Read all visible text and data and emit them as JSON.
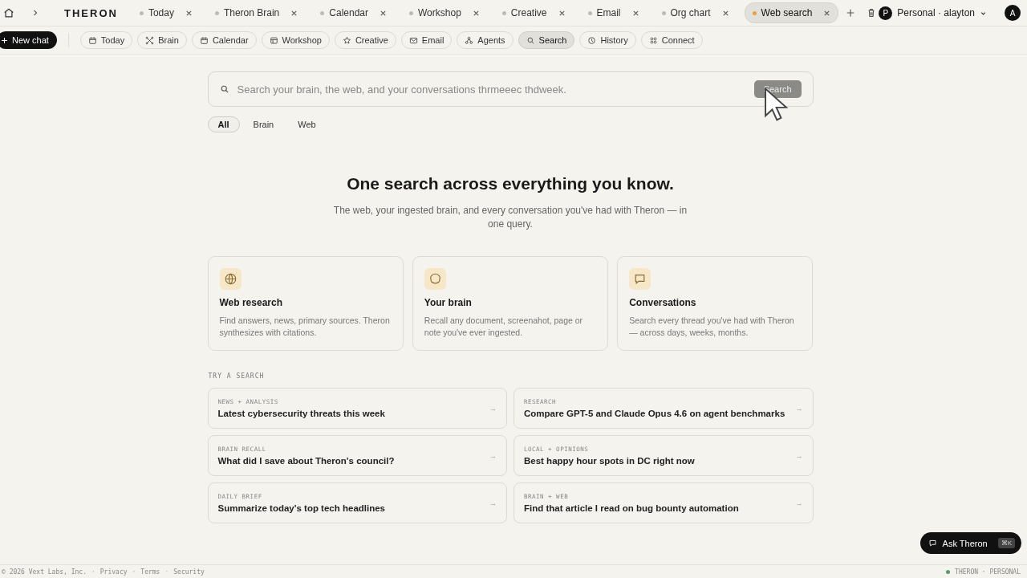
{
  "brand": "THERON",
  "tabs": [
    {
      "label": "Today",
      "selected": false
    },
    {
      "label": "Theron Brain",
      "selected": false
    },
    {
      "label": "Calendar",
      "selected": false
    },
    {
      "label": "Workshop",
      "selected": false
    },
    {
      "label": "Creative",
      "selected": false
    },
    {
      "label": "Email",
      "selected": false
    },
    {
      "label": "Org chart",
      "selected": false
    },
    {
      "label": "Web search",
      "selected": true
    }
  ],
  "account": {
    "avatar": "P",
    "label": "Personal · alayton",
    "user_avatar": "A"
  },
  "new_chat": "New chat",
  "nav": [
    {
      "label": "Today",
      "selected": false
    },
    {
      "label": "Brain",
      "selected": false
    },
    {
      "label": "Calendar",
      "selected": false
    },
    {
      "label": "Workshop",
      "selected": false
    },
    {
      "label": "Creative",
      "selected": false
    },
    {
      "label": "Email",
      "selected": false
    },
    {
      "label": "Agents",
      "selected": false
    },
    {
      "label": "Search",
      "selected": true
    },
    {
      "label": "History",
      "selected": false
    },
    {
      "label": "Connect",
      "selected": false
    }
  ],
  "search": {
    "value": "Search your brain, the web, and your conversations thrmeeec thdweek.",
    "button": "Search"
  },
  "filters": [
    {
      "label": "All",
      "selected": true
    },
    {
      "label": "Brain",
      "selected": false
    },
    {
      "label": "Web",
      "selected": false
    }
  ],
  "heading": "One search across everything you know.",
  "subheading": "The web, your ingested brain, and every conversation you've had with Theron — in one query.",
  "features": [
    {
      "title": "Web research",
      "text": "Find answers, news, primary sources. Theron synthesizes with citations."
    },
    {
      "title": "Your brain",
      "text": "Recall any document, screenahot, page or note you've ever ingested."
    },
    {
      "title": "Conversations",
      "text": "Search every thread you've had with Theron — across days, weeks, months."
    }
  ],
  "try_label": "TRY A SEARCH",
  "suggestions": [
    {
      "tag": "NEWS + ANALYSIS",
      "text": "Latest cybersecurity threats this week",
      "arrow": "→"
    },
    {
      "tag": "RESEARCH",
      "text": "Compare GPT-5 and Claude Opus 4.6 on agent benchmarks",
      "arrow": "→"
    },
    {
      "tag": "BRAIN RECALL",
      "text": "What did I save about Theron's council?",
      "arrow": "→"
    },
    {
      "tag": "LOCAL + OPINIONS",
      "text": "Best happy hour spots in DC right now",
      "arrow": "→"
    },
    {
      "tag": "DAILY BRIEF",
      "text": "Summarize today's top tech headlines",
      "arrow": "→"
    },
    {
      "tag": "BRAIN + WEB",
      "text": "Find that article I read on bug bounty automation",
      "arrow": "→"
    }
  ],
  "ask": {
    "label": "Ask Theron",
    "shortcut": "⌘K"
  },
  "footer": {
    "copyright": "© 2026 Vext Labs, Inc.",
    "separator": "·",
    "links": [
      "Privacy",
      "Terms",
      "Security"
    ],
    "status": "THERON · PERSONAL"
  }
}
